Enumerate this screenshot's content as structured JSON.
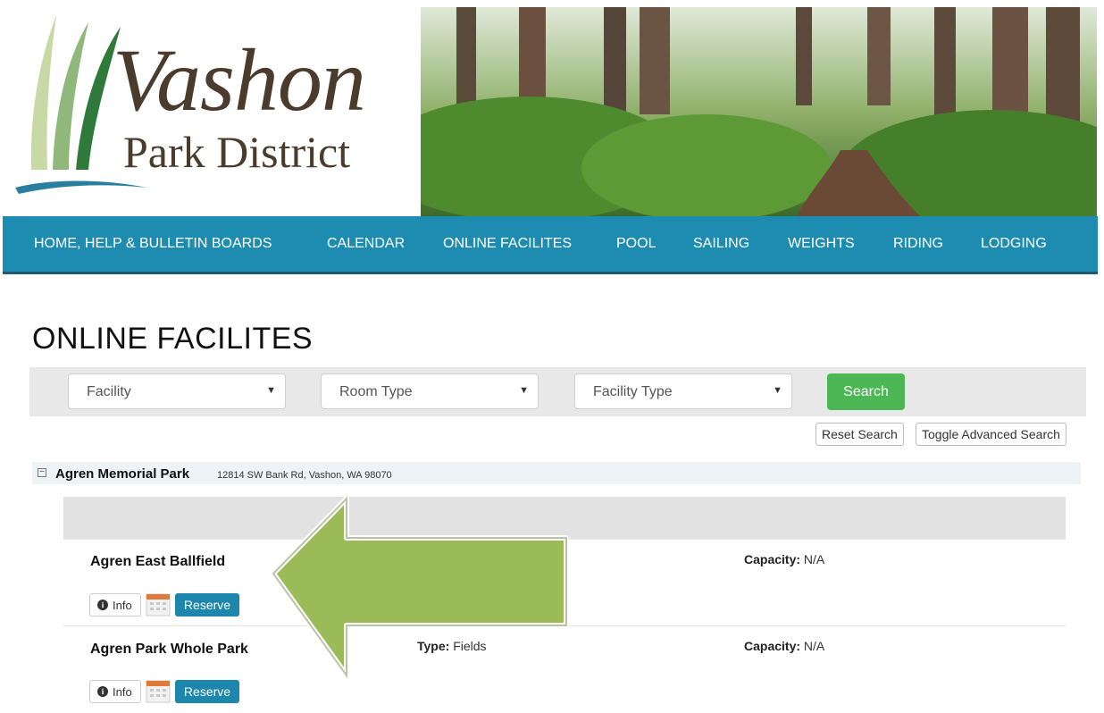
{
  "logo": {
    "title": "Vashon",
    "subtitle": "Park District"
  },
  "nav": {
    "items": [
      "HOME, HELP & BULLETIN BOARDS",
      "CALENDAR",
      "ONLINE FACILITES",
      "POOL",
      "SAILING",
      "WEIGHTS",
      "RIDING",
      "LODGING"
    ]
  },
  "page": {
    "title": "ONLINE FACILITES"
  },
  "search": {
    "facility_placeholder": "Facility",
    "room_type_placeholder": "Room Type",
    "facility_type_placeholder": "Facility Type",
    "search_label": "Search",
    "reset_label": "Reset Search",
    "toggle_label": "Toggle Advanced Search",
    "caret": "▼"
  },
  "park": {
    "name": "Agren Memorial Park",
    "address": "12814 SW Bank Rd, Vashon, WA 98070",
    "collapse_symbol": "−",
    "facilities": [
      {
        "name": "Agren East Ballfield",
        "type_label": "",
        "type_value": "",
        "capacity_label": "Capacity:",
        "capacity_value": "N/A"
      },
      {
        "name": "Agren Park Whole Park",
        "type_label": "Type:",
        "type_value": "Fields",
        "capacity_label": "Capacity:",
        "capacity_value": "N/A"
      }
    ],
    "info_label": "Info",
    "info_glyph": "i",
    "reserve_label": "Reserve"
  },
  "colors": {
    "nav_bg": "#1e8bb0",
    "search_button": "#4cb855",
    "reserve_button": "#1c86ac",
    "arrow": "#9bbb59",
    "logo_text": "#4a3b2c"
  },
  "icons": [
    "logo-grass-icon",
    "chevron-down-icon",
    "collapse-icon",
    "info-icon",
    "calendar-icon",
    "left-arrow-icon"
  ]
}
